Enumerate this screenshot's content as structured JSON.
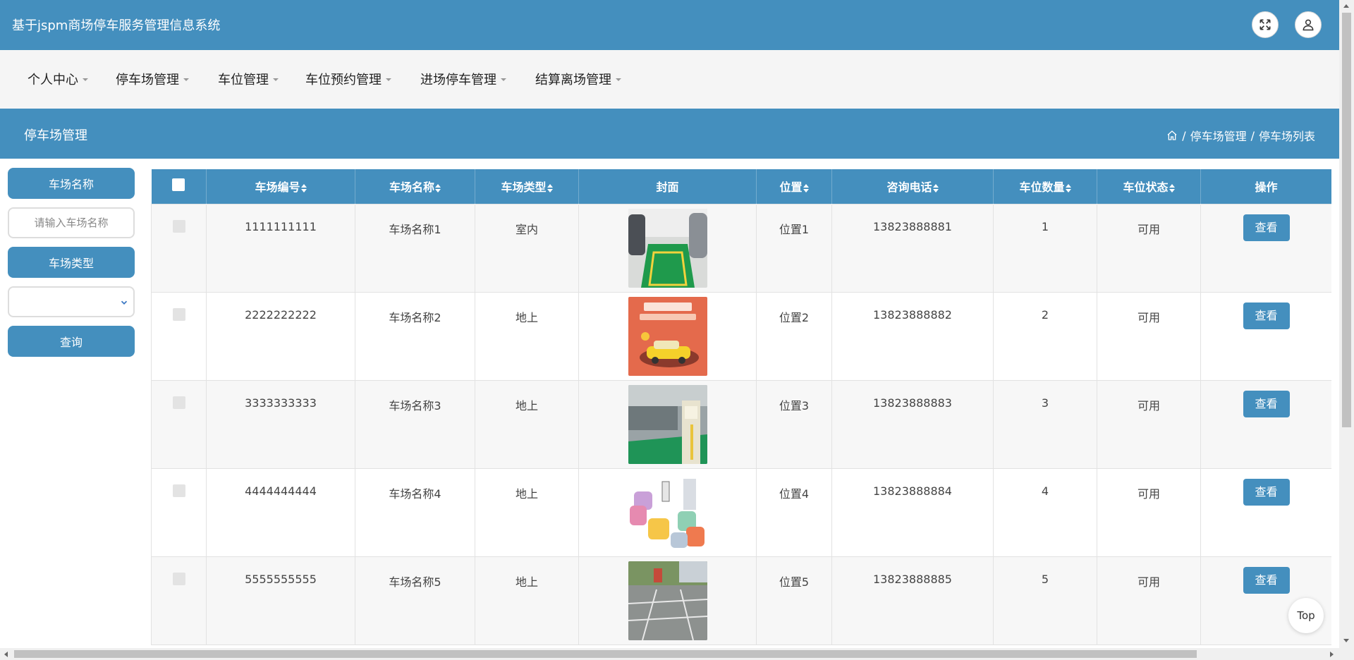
{
  "app": {
    "title": "基于jspm商场停车服务管理信息系统"
  },
  "header": {
    "fullscreen_icon": "expand-arrows-icon",
    "user_icon": "user-icon"
  },
  "nav": {
    "items": [
      {
        "label": "个人中心"
      },
      {
        "label": "停车场管理"
      },
      {
        "label": "车位管理"
      },
      {
        "label": "车位预约管理"
      },
      {
        "label": "进场停车管理"
      },
      {
        "label": "结算离场管理"
      }
    ]
  },
  "page": {
    "title": "停车场管理",
    "breadcrumb": {
      "home_icon": "home-icon",
      "sep": "/",
      "level1": "停车场管理",
      "level2": "停车场列表"
    }
  },
  "filters": {
    "name_label": "车场名称",
    "name_placeholder": "请输入车场名称",
    "type_label": "车场类型",
    "type_value": "",
    "search_label": "查询"
  },
  "table": {
    "columns": [
      "车场编号",
      "车场名称",
      "车场类型",
      "封面",
      "位置",
      "咨询电话",
      "车位数量",
      "车位状态",
      "操作"
    ],
    "rows": [
      {
        "id": "1111111111",
        "name": "车场名称1",
        "type": "室内",
        "location": "位置1",
        "phone": "13823888881",
        "count": "1",
        "status": "可用",
        "action": "查看"
      },
      {
        "id": "2222222222",
        "name": "车场名称2",
        "type": "地上",
        "location": "位置2",
        "phone": "13823888882",
        "count": "2",
        "status": "可用",
        "action": "查看"
      },
      {
        "id": "3333333333",
        "name": "车场名称3",
        "type": "地上",
        "location": "位置3",
        "phone": "13823888883",
        "count": "3",
        "status": "可用",
        "action": "查看"
      },
      {
        "id": "4444444444",
        "name": "车场名称4",
        "type": "地上",
        "location": "位置4",
        "phone": "13823888884",
        "count": "4",
        "status": "可用",
        "action": "查看"
      },
      {
        "id": "5555555555",
        "name": "车场名称5",
        "type": "地上",
        "location": "位置5",
        "phone": "13823888885",
        "count": "5",
        "status": "可用",
        "action": "查看"
      }
    ]
  },
  "scroll_top": {
    "label": "Top"
  },
  "colors": {
    "primary": "#448fbe",
    "nav_bg": "#f5f5f5"
  }
}
